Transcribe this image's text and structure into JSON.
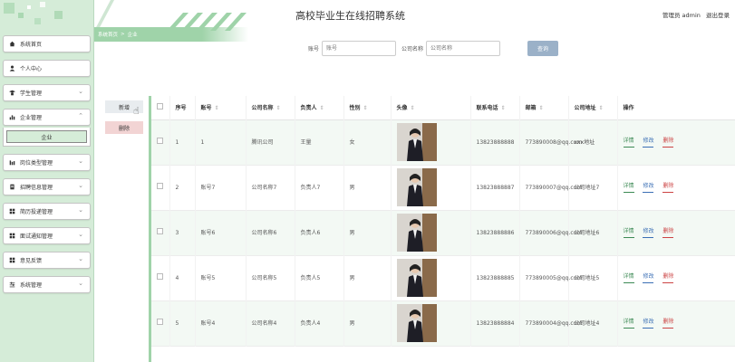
{
  "header": {
    "site_title": "高校毕业生在线招聘系统",
    "admin_label": "管理员 admin",
    "logout_label": "退出登录"
  },
  "breadcrumb": {
    "home": "系统首页",
    "current": "企业"
  },
  "sidebar": {
    "items": [
      {
        "label": "系统首页",
        "icon": "home-icon"
      },
      {
        "label": "个人中心",
        "icon": "user-icon"
      },
      {
        "label": "学生管理",
        "icon": "student-icon"
      },
      {
        "label": "企业管理",
        "icon": "bar-chart-icon"
      },
      {
        "label": "岗位类型管理",
        "icon": "bar-chart-icon"
      },
      {
        "label": "招聘信息管理",
        "icon": "document-icon"
      },
      {
        "label": "简历投递管理",
        "icon": "grid-icon"
      },
      {
        "label": "面试通知管理",
        "icon": "grid-icon"
      },
      {
        "label": "意见反馈",
        "icon": "grid-icon"
      },
      {
        "label": "系统管理",
        "icon": "sliders-icon"
      }
    ],
    "submenu_label": "企业"
  },
  "search": {
    "account_label": "账号",
    "account_placeholder": "账号",
    "company_label": "公司名称",
    "company_placeholder": "公司名称",
    "button_label": "查询"
  },
  "actions": {
    "add_label": "新增",
    "delete_label": "删除"
  },
  "table": {
    "headers": [
      "序号",
      "账号",
      "公司名称",
      "负责人",
      "性别",
      "头像",
      "联系电话",
      "邮箱",
      "公司地址",
      "操作"
    ],
    "sort_mark": "⇕",
    "rows": [
      {
        "index": "1",
        "account": "1",
        "company": "腾讯公司",
        "manager": "王量",
        "gender": "女",
        "phone": "13823888888",
        "email": "773890008@qq.com",
        "address": "xxx地址"
      },
      {
        "index": "2",
        "account": "账号7",
        "company": "公司名称7",
        "manager": "负责人7",
        "gender": "男",
        "phone": "13823888887",
        "email": "773890007@qq.com",
        "address": "公司地址7"
      },
      {
        "index": "3",
        "account": "账号6",
        "company": "公司名称6",
        "manager": "负责人6",
        "gender": "男",
        "phone": "13823888886",
        "email": "773890006@qq.com",
        "address": "公司地址6"
      },
      {
        "index": "4",
        "account": "账号5",
        "company": "公司名称5",
        "manager": "负责人5",
        "gender": "男",
        "phone": "13823888885",
        "email": "773890005@qq.com",
        "address": "公司地址5"
      },
      {
        "index": "5",
        "account": "账号4",
        "company": "公司名称4",
        "manager": "负责人4",
        "gender": "男",
        "phone": "13823888884",
        "email": "773890004@qq.com",
        "address": "公司地址4"
      }
    ],
    "ops": {
      "detail": "详情",
      "edit": "修改",
      "delete": "删除"
    }
  },
  "colors": {
    "accent_green": "#9fd3a9",
    "sidebar_bg": "#d5ecd8",
    "search_button": "#9bb1c8"
  }
}
